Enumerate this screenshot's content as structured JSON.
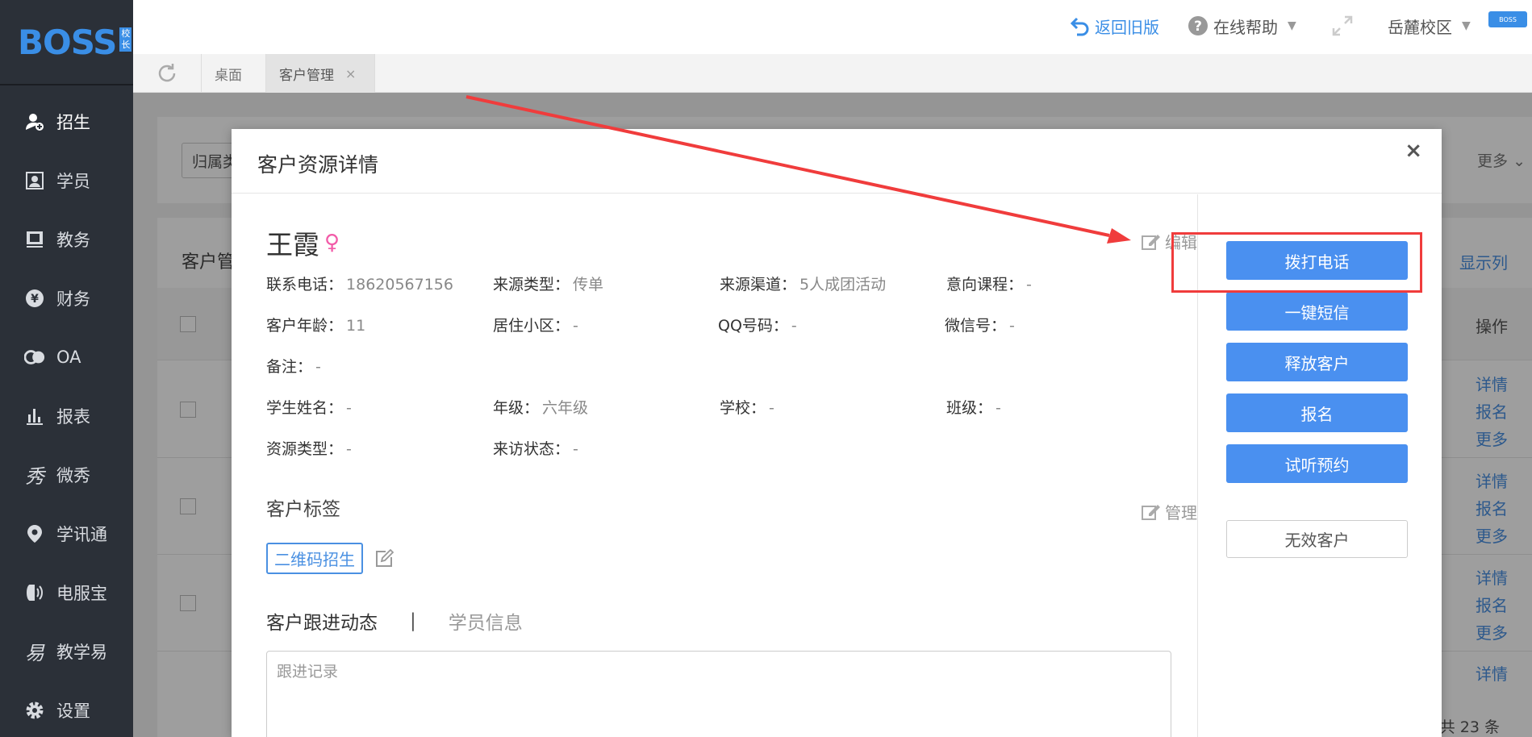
{
  "sidebar": {
    "logo": "BOSS",
    "logo_badge": [
      "校",
      "长"
    ],
    "items": [
      {
        "label": "招生",
        "icon": "user-add-icon",
        "active": true
      },
      {
        "label": "学员",
        "icon": "id-card-icon"
      },
      {
        "label": "教务",
        "icon": "book-icon"
      },
      {
        "label": "财务",
        "icon": "yen-icon"
      },
      {
        "label": "OA",
        "icon": "oa-icon"
      },
      {
        "label": "报表",
        "icon": "bar-chart-icon"
      },
      {
        "label": "微秀",
        "icon": "xiu-icon"
      },
      {
        "label": "学讯通",
        "icon": "location-pin-icon"
      },
      {
        "label": "电服宝",
        "icon": "phone-service-icon"
      },
      {
        "label": "教学易",
        "icon": "yi-icon"
      },
      {
        "label": "设置",
        "icon": "gear-icon"
      }
    ]
  },
  "header": {
    "back_old": "返回旧版",
    "help": "在线帮助",
    "campus": "岳麓校区",
    "avatar_text": "BOSS"
  },
  "tabs": {
    "items": [
      {
        "label": "桌面"
      },
      {
        "label": "客户管理",
        "active": true
      }
    ]
  },
  "background": {
    "filter_label": "归属类",
    "more": "更多",
    "list_title": "客户管",
    "show_columns": "显示列",
    "op_header": "操作",
    "row_links": [
      "详情",
      "报名",
      "更多"
    ],
    "total": "共 23 条"
  },
  "modal": {
    "title": "客户资源详情",
    "close": "×",
    "customer_name": "王霞",
    "gender": "♀",
    "edit": "编辑",
    "fields": {
      "phone_label": "联系电话：",
      "phone": "18620567156",
      "source_type_label": "来源类型：",
      "source_type": "传单",
      "channel_label": "来源渠道：",
      "channel": "5人成团活动",
      "course_label": "意向课程：",
      "course": "-",
      "age_label": "客户年龄：",
      "age": "11",
      "community_label": "居住小区：",
      "community": "-",
      "qq_label": "QQ号码：",
      "qq": "-",
      "wechat_label": "微信号：",
      "wechat": "-",
      "remark_label": "备注：",
      "remark": "-",
      "student_label": "学生姓名：",
      "student": "-",
      "grade_label": "年级：",
      "grade": "六年级",
      "school_label": "学校：",
      "school": "-",
      "class_label": "班级：",
      "class": "-",
      "resource_label": "资源类型：",
      "resource": "-",
      "visit_label": "来访状态：",
      "visit": "-"
    },
    "tags_title": "客户标签",
    "manage": "管理",
    "tag": "二维码招生",
    "subtab_follow": "客户跟进动态",
    "subtab_sep": "|",
    "subtab_student": "学员信息",
    "follow_placeholder": "跟进记录",
    "actions": {
      "call": "拨打电话",
      "sms": "一键短信",
      "release": "释放客户",
      "enroll": "报名",
      "trial": "试听预约",
      "invalid": "无效客户"
    }
  },
  "colors": {
    "accent": "#4a90f0",
    "annotation": "#f03c3c",
    "sidebar_bg": "#2b3038"
  }
}
